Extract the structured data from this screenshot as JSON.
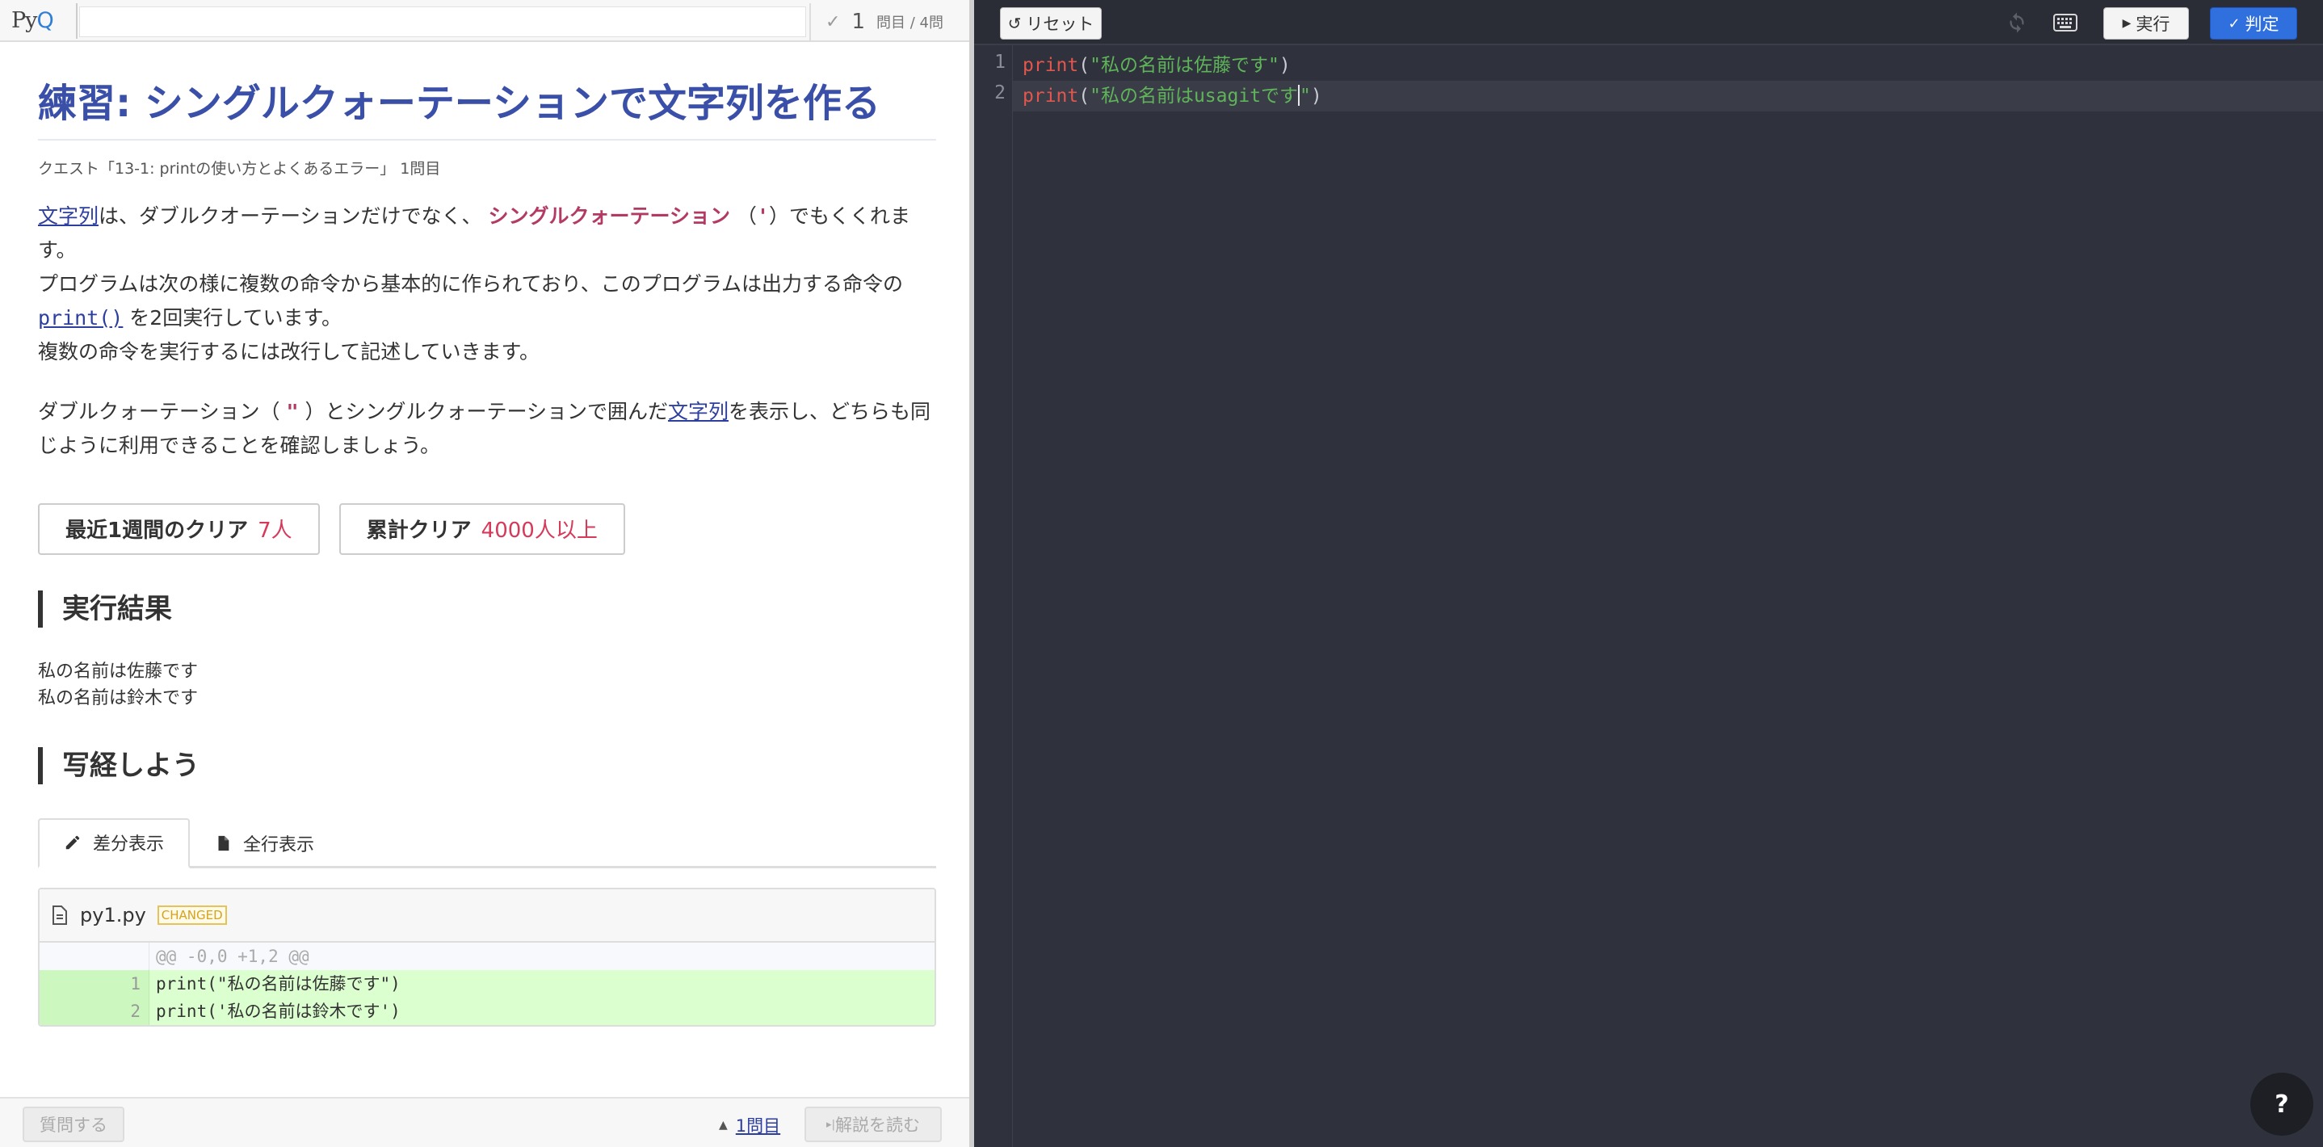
{
  "header": {
    "logo_p": "P",
    "logo_y": "y",
    "logo_q": "Q",
    "progress_current": "1",
    "progress_total": "問目 / 4問"
  },
  "exercise": {
    "title": "練習: シングルクォーテーションで文字列を作る",
    "quest_line": "クエスト「13-1: printの使い方とよくあるエラー」 1問目",
    "para1": {
      "link_string": "文字列",
      "t1": "は、ダブルクオーテーションだけでなく、 ",
      "em_single": "シングルクォーテーション",
      "t2": " （",
      "single_quote": "'",
      "t3": "）でもくくれます。",
      "t4": "プログラムは次の様に複数の命令から基本的に作られており、このプログラムは出力する命令の",
      "print_link": "print()",
      "t5": " を2回実行しています。",
      "t6": "複数の命令を実行するには改行して記述していきます。"
    },
    "para2": {
      "t1": "ダブルクォーテーション（ ",
      "double_quote": "\"",
      "t2": " ）とシングルクォーテーションで囲んだ",
      "link_string": "文字列",
      "t3": "を表示し、どちらも同じように利用できることを確認しましょう。"
    }
  },
  "stats": {
    "weekly_label": "最近1週間のクリア",
    "weekly_value": "7人",
    "total_label": "累計クリア",
    "total_value": "4000人以上"
  },
  "result": {
    "heading": "実行結果",
    "lines": [
      "私の名前は佐藤です",
      "私の名前は鈴木です"
    ]
  },
  "copy": {
    "heading": "写経しよう",
    "tab_diff": "差分表示",
    "tab_all": "全行表示",
    "file_name": "py1.py",
    "badge": "CHANGED",
    "hunk": "@@ -0,0 +1,2 @@",
    "rows": [
      {
        "ln": "1",
        "code": "print(\"私の名前は佐藤です\")"
      },
      {
        "ln": "2",
        "code": "print('私の名前は鈴木です')"
      }
    ]
  },
  "bottom": {
    "ask": "質問する",
    "nav": "1問目",
    "hint": "解説を読む"
  },
  "editor": {
    "reset": "リセット",
    "run": "実行",
    "judge": "判定",
    "help": "?",
    "lines": [
      {
        "ln": "1",
        "kw": "print",
        "open": "(",
        "str": "\"私の名前は佐藤です\"",
        "close": ")"
      },
      {
        "ln": "2",
        "kw": "print",
        "open": "(",
        "str_a": "\"私の名前はusagitです",
        "str_b": "\"",
        "close": ")"
      }
    ]
  },
  "colors": {
    "title": "#3a4fa8",
    "accent_red": "#d63a5a",
    "judge_blue": "#2f6fde",
    "editor_bg": "#2f323c"
  }
}
